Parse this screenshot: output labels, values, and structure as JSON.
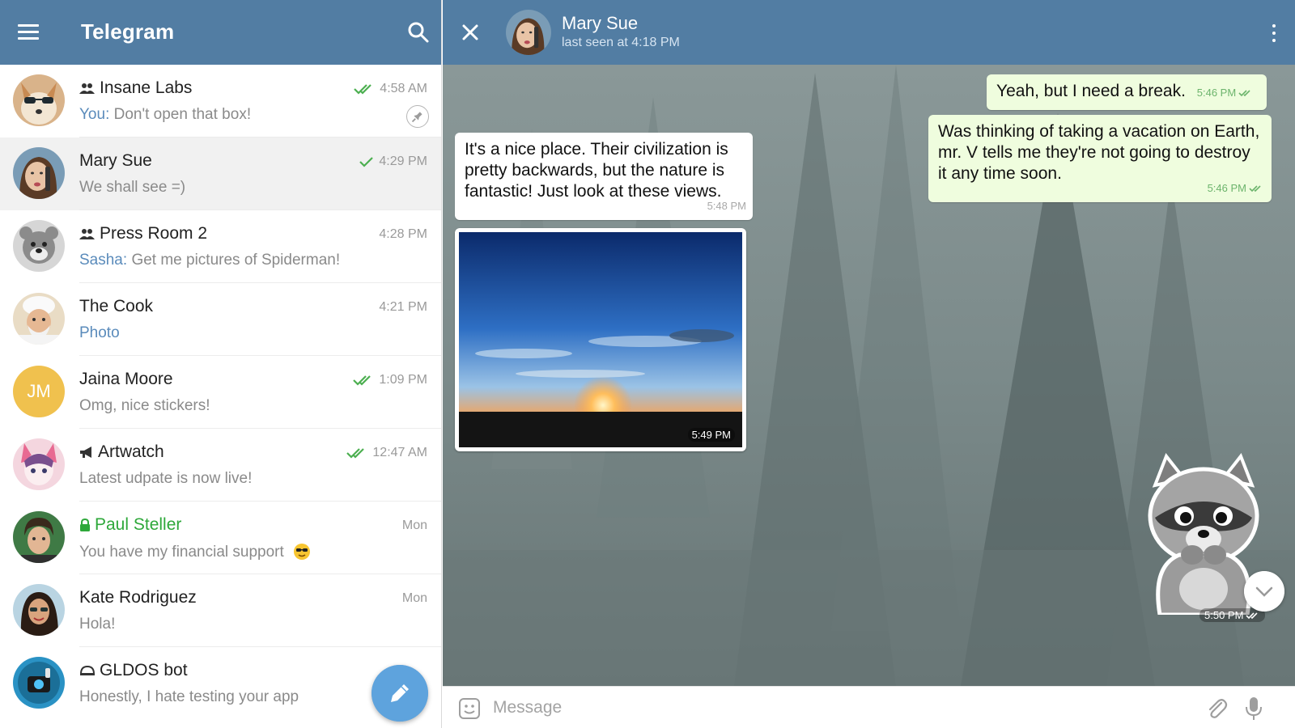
{
  "app": {
    "title": "Telegram",
    "accent": "#527da3"
  },
  "chats": [
    {
      "name": "Insane Labs",
      "kind": "group",
      "sender": "You:",
      "preview": "Don't open that box!",
      "time": "4:58 AM",
      "read": "double",
      "pinned": true
    },
    {
      "name": "Mary Sue",
      "kind": "user",
      "sender": "",
      "preview": "We shall see =)",
      "time": "4:29 PM",
      "read": "single",
      "active": true
    },
    {
      "name": "Press Room 2",
      "kind": "group",
      "sender": "Sasha:",
      "preview": "Get me pictures of Spiderman!",
      "time": "4:28 PM",
      "read": "none"
    },
    {
      "name": "The Cook",
      "kind": "user",
      "sender": "",
      "preview": "Photo",
      "time": "4:21 PM",
      "read": "none"
    },
    {
      "name": "Jaina Moore",
      "kind": "user",
      "initials": "JM",
      "sender": "",
      "preview": "Omg, nice stickers!",
      "time": "1:09 PM",
      "read": "double"
    },
    {
      "name": "Artwatch",
      "kind": "channel",
      "sender": "",
      "preview": "Latest udpate is now live!",
      "time": "12:47 AM",
      "read": "double"
    },
    {
      "name": "Paul Steller",
      "kind": "secret",
      "sender": "",
      "preview": "You have my financial support",
      "time": "Mon",
      "read": "none"
    },
    {
      "name": "Kate Rodriguez",
      "kind": "user",
      "sender": "",
      "preview": "Hola!",
      "time": "Mon",
      "read": "none"
    },
    {
      "name": "GLDOS bot",
      "kind": "bot",
      "sender": "",
      "preview": "Honestly, I hate testing your app",
      "time": "",
      "read": "none"
    }
  ],
  "conversation": {
    "name": "Mary Sue",
    "status": "last seen at 4:18 PM",
    "messages": [
      {
        "dir": "out",
        "text": "Yeah, but I need a break.",
        "time": "5:46 PM"
      },
      {
        "dir": "out",
        "text": "Was thinking of taking a vacation on Earth, mr. V tells me they're not going to destroy it any time soon.",
        "time": "5:46 PM"
      },
      {
        "dir": "in",
        "text": "It's a nice place. Their civilization is pretty backwards, but the nature is fantastic! Just look at these views.",
        "time": "5:48 PM"
      },
      {
        "dir": "in",
        "type": "photo",
        "time": "5:49 PM"
      },
      {
        "dir": "out",
        "type": "sticker",
        "time": "5:50 PM"
      }
    ]
  },
  "composer": {
    "placeholder": "Message"
  },
  "icons": {
    "menu": "hamburger-icon",
    "search": "search-icon",
    "close": "close-icon",
    "more": "more-vertical-icon",
    "compose": "pencil-icon",
    "emoji": "smiley-icon",
    "attach": "paperclip-icon",
    "voice": "microphone-icon"
  }
}
